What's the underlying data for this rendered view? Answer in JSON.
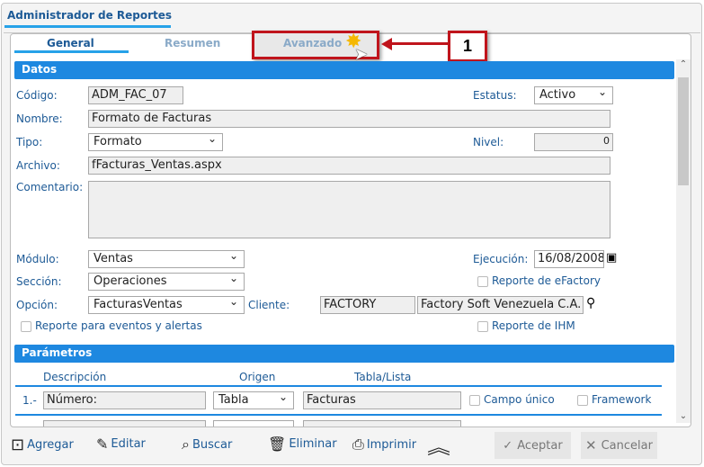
{
  "window": {
    "title": "Administrador de Reportes"
  },
  "tabs": [
    {
      "label": "General"
    },
    {
      "label": "Resumen"
    },
    {
      "label": "Avanzado"
    }
  ],
  "callout": {
    "number": "1"
  },
  "datos": {
    "header": "Datos",
    "codigo": {
      "label": "Código:",
      "value": "ADM_FAC_07"
    },
    "estatus": {
      "label": "Estatus:",
      "value": "Activo"
    },
    "nombre": {
      "label": "Nombre:",
      "value": "Formato de Facturas"
    },
    "tipo": {
      "label": "Tipo:",
      "value": "Formato"
    },
    "nivel": {
      "label": "Nivel:",
      "value": "0"
    },
    "archivo": {
      "label": "Archivo:",
      "value": "fFacturas_Ventas.aspx"
    },
    "comentario": {
      "label": "Comentario:",
      "value": ""
    },
    "modulo": {
      "label": "Módulo:",
      "value": "Ventas"
    },
    "ejecucion": {
      "label": "Ejecución:",
      "value": "16/08/2008"
    },
    "seccion": {
      "label": "Sección:",
      "value": "Operaciones"
    },
    "reporte_efactory": "Reporte de eFactory",
    "opcion": {
      "label": "Opción:",
      "value": "FacturasVentas"
    },
    "cliente": {
      "label": "Cliente:",
      "code": "FACTORY",
      "name": "Factory Soft Venezuela C.A."
    },
    "reporte_eventos": "Reporte para eventos y alertas",
    "reporte_ihm": "Reporte de IHM"
  },
  "parametros": {
    "header": "Parámetros",
    "columns": [
      "Descripción",
      "Origen",
      "Tabla/Lista"
    ],
    "rows": [
      {
        "index": "1.-",
        "descripcion": "Número:",
        "origen": "Tabla",
        "tabla": "Facturas",
        "campo_unico": "Campo único",
        "framework": "Framework"
      }
    ]
  },
  "toolbar": {
    "agregar": "Agregar",
    "editar": "Editar",
    "buscar": "Buscar",
    "eliminar": "Eliminar",
    "imprimir": "Imprimir",
    "aceptar": "Aceptar",
    "cancelar": "Cancelar"
  }
}
